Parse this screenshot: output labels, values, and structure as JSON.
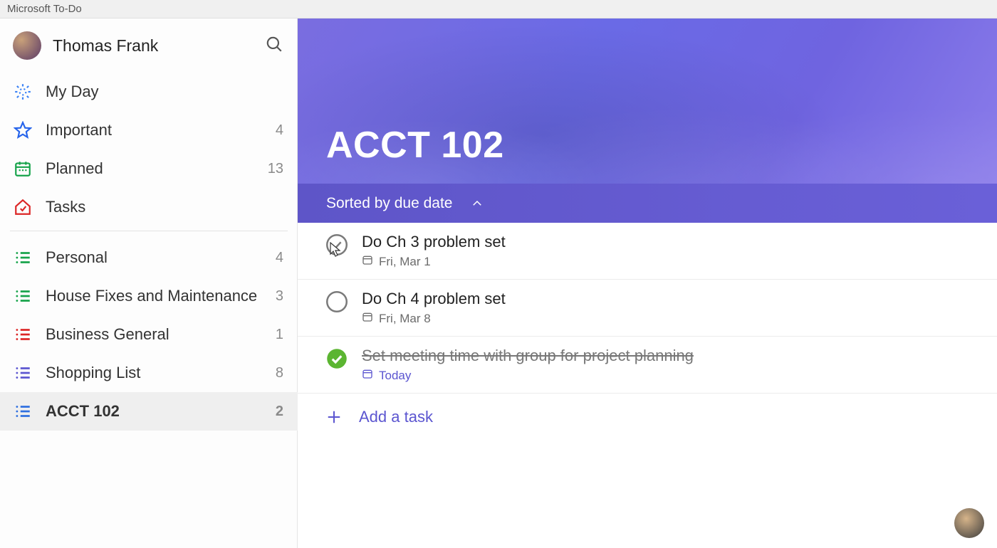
{
  "app": {
    "title": "Microsoft To-Do"
  },
  "user": {
    "name": "Thomas Frank"
  },
  "smart_lists": [
    {
      "id": "myday",
      "label": "My Day",
      "count": "",
      "color": "#3b82f6",
      "icon": "sun"
    },
    {
      "id": "important",
      "label": "Important",
      "count": "4",
      "color": "#2563eb",
      "icon": "star"
    },
    {
      "id": "planned",
      "label": "Planned",
      "count": "13",
      "color": "#16a34a",
      "icon": "calendar"
    },
    {
      "id": "tasks",
      "label": "Tasks",
      "count": "",
      "color": "#dc2626",
      "icon": "home-check"
    }
  ],
  "custom_lists": [
    {
      "id": "personal",
      "label": "Personal",
      "count": "4",
      "color": "#16a34a"
    },
    {
      "id": "house",
      "label": "House Fixes and Maintenance",
      "count": "3",
      "color": "#16a34a"
    },
    {
      "id": "business",
      "label": "Business General",
      "count": "1",
      "color": "#dc2626"
    },
    {
      "id": "shopping",
      "label": "Shopping List",
      "count": "8",
      "color": "#5b55d0"
    },
    {
      "id": "acct102",
      "label": "ACCT 102",
      "count": "2",
      "color": "#2f6fe0",
      "selected": true
    }
  ],
  "main": {
    "title": "ACCT 102",
    "sort_label": "Sorted by due date",
    "add_task_label": "Add a task"
  },
  "tasks": [
    {
      "title": "Do Ch 3 problem set",
      "due": "Fri, Mar 1",
      "due_kind": "normal",
      "completed": false,
      "hover": true
    },
    {
      "title": "Do Ch 4 problem set",
      "due": "Fri, Mar 8",
      "due_kind": "normal",
      "completed": false,
      "hover": false
    },
    {
      "title": "Set meeting time with group for project planning",
      "due": "Today",
      "due_kind": "today",
      "completed": true,
      "hover": false
    }
  ]
}
